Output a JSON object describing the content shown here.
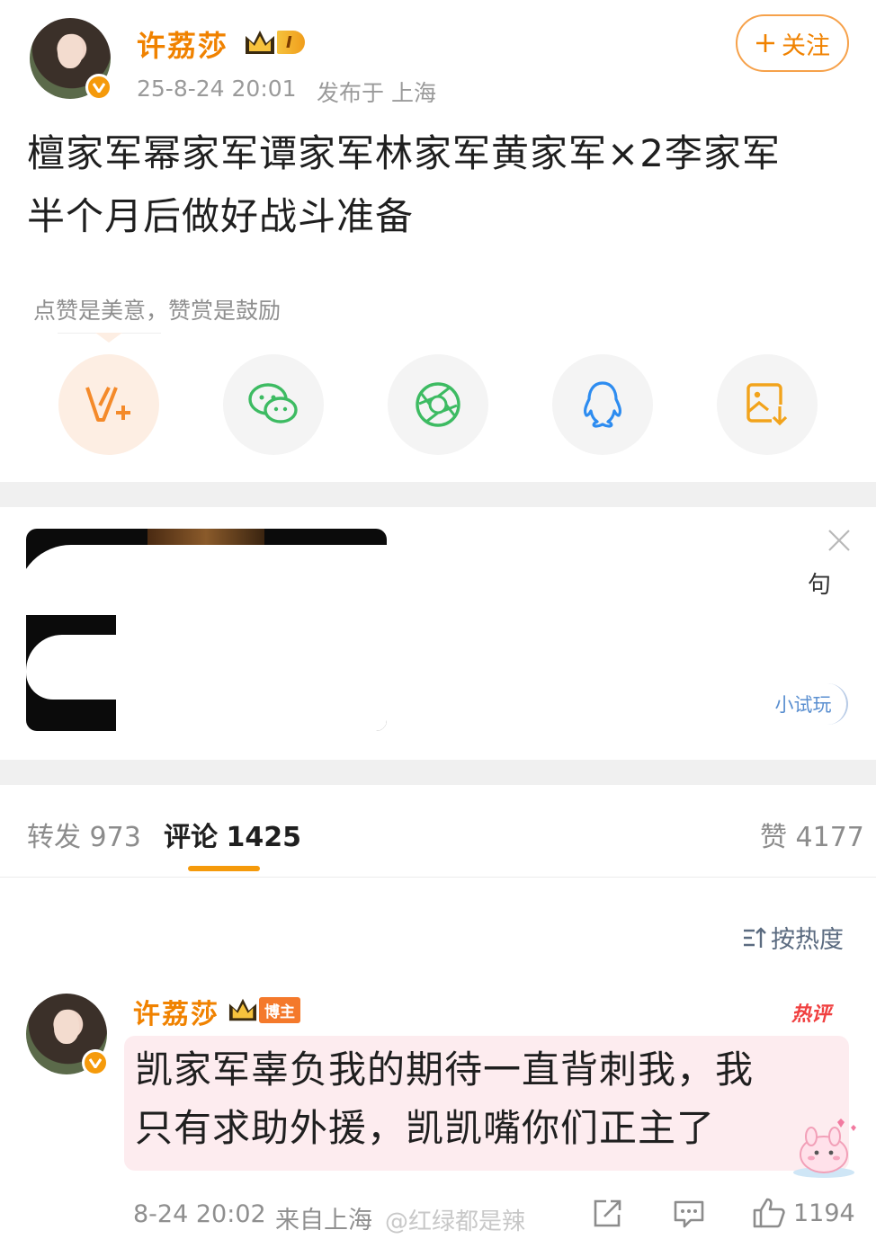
{
  "post": {
    "author": "许荔莎",
    "level": "I",
    "date": "25-8-24 20:01",
    "location": "发布于 上海",
    "follow_label": "关注",
    "text_line1": "檀家军幂家军谭家军林家军黄家军×2李家军",
    "text_line2": "半个月后做好战斗准备"
  },
  "reward": {
    "tip": "点赞是美意，赞赏是鼓励"
  },
  "share_icons": [
    "v-plus-icon",
    "wechat-icon",
    "moments-icon",
    "qq-icon",
    "save-image-icon"
  ],
  "ad": {
    "side_text": "句",
    "cta": "小试玩"
  },
  "tabs": {
    "repost_label": "转发",
    "repost_count": "973",
    "comment_label": "评论",
    "comment_count": "1425",
    "like_label": "赞",
    "like_count": "4177",
    "sort_label": "按热度"
  },
  "comment": {
    "author": "许荔莎",
    "badge": "博主",
    "hot": "热评",
    "text_line1": "凯家军辜负我的期待一直背刺我，我",
    "text_line2": "只有求助外援，凯凯嘴你们正主了",
    "time": "8-24 20:02",
    "source": "来自上海",
    "watermark": "@红绿都是辣",
    "like_count": "1194"
  },
  "colors": {
    "accent": "#f08200",
    "divider": "#f0f0f0",
    "hot": "#f04040",
    "bubble": "#fdecef"
  }
}
